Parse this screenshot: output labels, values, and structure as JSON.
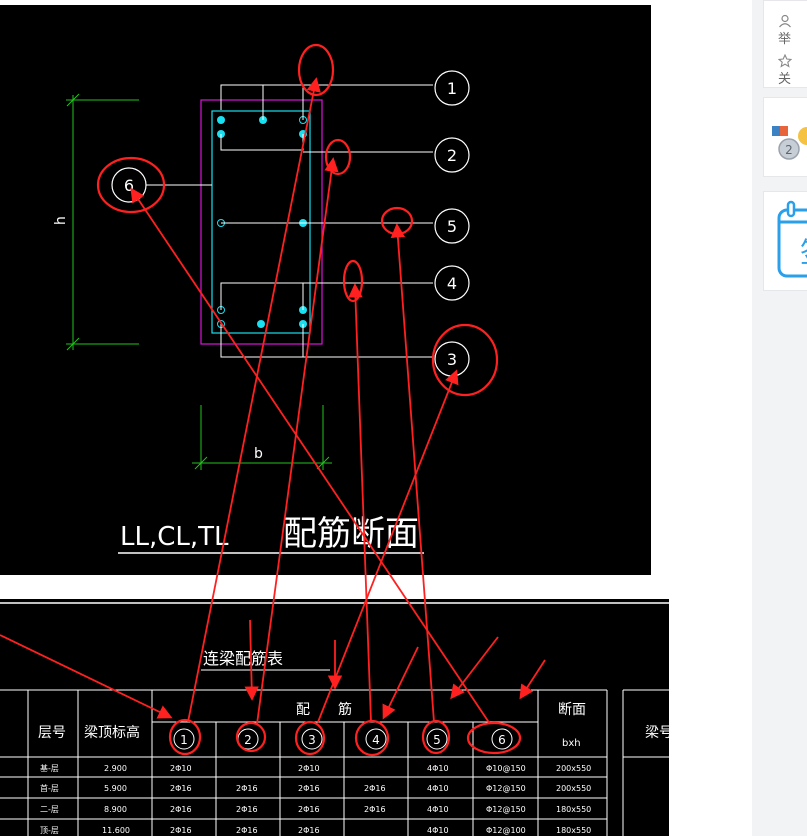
{
  "drawing": {
    "title_code": "LL,CL,TL",
    "title_name": "配筋断面",
    "dim_h": "h",
    "dim_b": "b",
    "markers": [
      "1",
      "2",
      "5",
      "4",
      "3",
      "6"
    ]
  },
  "table": {
    "title": "连梁配筋表",
    "col_floor": "层号",
    "col_elev": "梁顶标高",
    "col_rebar": "配　　筋",
    "col_section": "断面",
    "col_section_sub": "bxh",
    "col_beam": "梁号",
    "headers_num": [
      "1",
      "2",
      "3",
      "4",
      "5",
      "6"
    ],
    "rows": [
      {
        "floor": "基-层",
        "elev": "2.900",
        "c1": "2Φ10",
        "c2": "",
        "c3": "2Φ10",
        "c4": "",
        "c5": "4Φ10",
        "c6": "Φ10@150",
        "sec": "200x550"
      },
      {
        "floor": "首-层",
        "elev": "5.900",
        "c1": "2Φ16",
        "c2": "2Φ16",
        "c3": "2Φ16",
        "c4": "2Φ16",
        "c5": "4Φ10",
        "c6": "Φ12@150",
        "sec": "200x550"
      },
      {
        "floor": "二-层",
        "elev": "8.900",
        "c1": "2Φ16",
        "c2": "2Φ16",
        "c3": "2Φ16",
        "c4": "2Φ16",
        "c5": "4Φ10",
        "c6": "Φ12@150",
        "sec": "180x550"
      },
      {
        "floor": "顶-层",
        "elev": "11.600",
        "c1": "2Φ16",
        "c2": "2Φ16",
        "c3": "2Φ16",
        "c4": "",
        "c5": "4Φ10",
        "c6": "Φ12@100",
        "sec": "180x550"
      }
    ]
  },
  "sidebar": {
    "row1_text": "举",
    "row2_text": "关",
    "medal_number": "2",
    "calendar_text": "签"
  },
  "colors": {
    "cad_bg": "#000000",
    "cad_white": "#ffffff",
    "cad_green": "#22c41e",
    "cad_magenta": "#d814d8",
    "cad_cyan": "#18e0f0",
    "annotation_red": "#ff2020",
    "sidebar_bg": "#f2f3f5",
    "calendar_blue": "#2aa0ea"
  },
  "icons": [
    "user-icon",
    "star-icon",
    "medal-icon",
    "calendar-icon"
  ]
}
